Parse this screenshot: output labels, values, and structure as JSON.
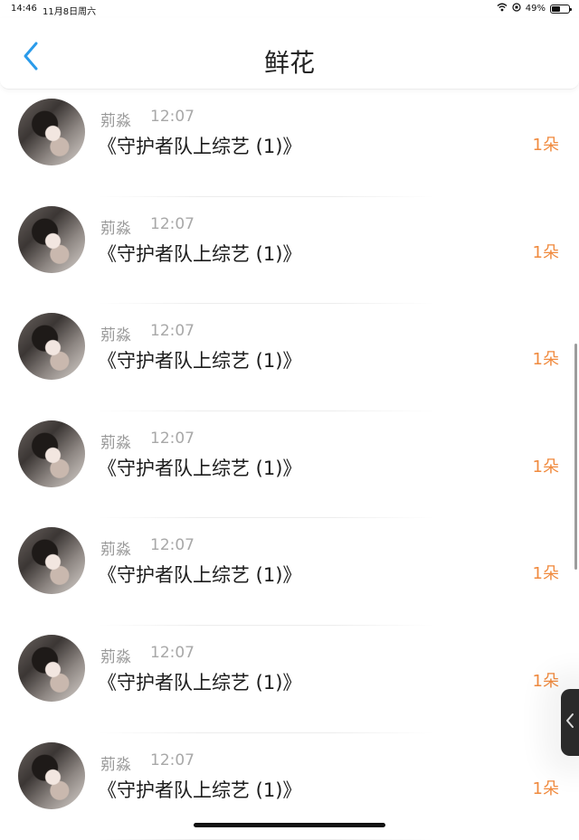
{
  "status_bar": {
    "time": "14:46",
    "date": "11月8日周六",
    "battery": "49%",
    "battery_level": 0.49
  },
  "header": {
    "title": "鲜花",
    "back_icon": "chevron-left-icon",
    "accent_color": "#2a9bea"
  },
  "list": {
    "items": [
      {
        "name": "莂淼",
        "time": "12:07",
        "title": "《守护者队上综艺 (1)》",
        "count": "1朵"
      },
      {
        "name": "莂淼",
        "time": "12:07",
        "title": "《守护者队上综艺 (1)》",
        "count": "1朵"
      },
      {
        "name": "莂淼",
        "time": "12:07",
        "title": "《守护者队上综艺 (1)》",
        "count": "1朵"
      },
      {
        "name": "莂淼",
        "time": "12:07",
        "title": "《守护者队上综艺 (1)》",
        "count": "1朵"
      },
      {
        "name": "莂淼",
        "time": "12:07",
        "title": "《守护者队上综艺 (1)》",
        "count": "1朵"
      },
      {
        "name": "莂淼",
        "time": "12:07",
        "title": "《守护者队上综艺 (1)》",
        "count": "1朵"
      },
      {
        "name": "莂淼",
        "time": "12:07",
        "title": "《守护者队上综艺 (1)》",
        "count": "1朵"
      }
    ],
    "count_color": "#f08a3e"
  }
}
